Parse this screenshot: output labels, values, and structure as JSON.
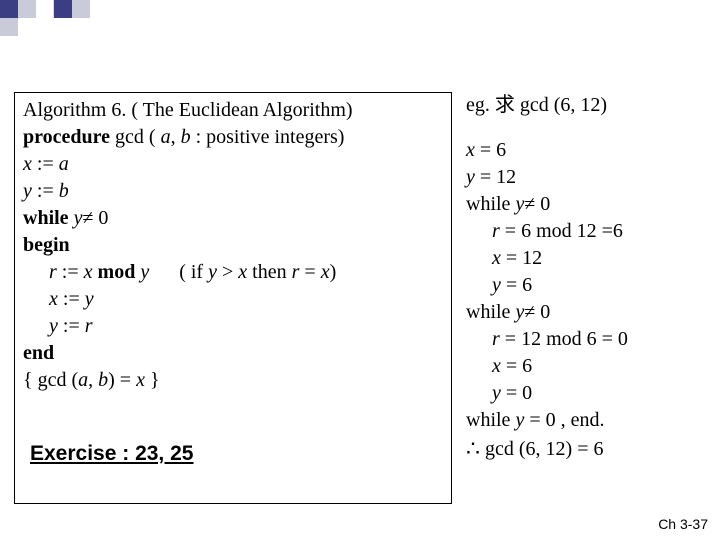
{
  "decor": {
    "colors": [
      "#3B3E82",
      "#C9CBD9",
      "#FFFFFF",
      "#3B3E82",
      "#C9CBD9",
      "#FFFFFF"
    ]
  },
  "algo": {
    "title_a": "Algorithm 6. ",
    "title_b": "( The Euclidean Algorithm)",
    "line2_a": "procedure ",
    "line2_b": "gcd ( ",
    "line2_c": "a",
    "line2_d": ", ",
    "line2_e": "b",
    "line2_f": " : positive integers)",
    "line3_a": "x",
    "line3_b": " := ",
    "line3_c": "a",
    "line4_a": "y",
    "line4_b": " := ",
    "line4_c": "b",
    "line5_a": "while ",
    "line5_b": "y",
    "line5_c": "≠ 0",
    "line6": "begin",
    "line7_a": "r",
    "line7_b": " := ",
    "line7_c": "x",
    "line7_d": " mod ",
    "line7_e": "y",
    "line7_gap": "      ",
    "line7_f": "( if ",
    "line7_g": "y",
    "line7_h": " > ",
    "line7_i": "x",
    "line7_j": " then ",
    "line7_k": "r",
    "line7_l": " = ",
    "line7_m": "x",
    "line7_n": ")",
    "line8_a": "x",
    "line8_b": " := ",
    "line8_c": "y",
    "line9_a": "y",
    "line9_b": " := ",
    "line9_c": "r",
    "line10": "end",
    "line11_a": "{ gcd (",
    "line11_b": "a",
    "line11_c": ", ",
    "line11_d": "b",
    "line11_e": ") = ",
    "line11_f": "x",
    "line11_g": " }"
  },
  "right": {
    "eg": "eg. 求 gcd (6, 12)",
    "r1_a": "x",
    "r1_b": " = 6",
    "r2_a": "y",
    "r2_b": " = 12",
    "r3_a": "while ",
    "r3_b": "y",
    "r3_c": "≠ 0",
    "r4_a": "r",
    "r4_b": " = 6 mod 12 =6",
    "r5_a": "x",
    "r5_b": " = 12",
    "r6_a": "y",
    "r6_b": " = 6",
    "r7_a": "while ",
    "r7_b": "y",
    "r7_c": "≠ 0",
    "r8_a": "r",
    "r8_b": " = 12 mod 6 = 0",
    "r9_a": "x",
    "r9_b": " = 6",
    "r10_a": "y",
    "r10_b": " = 0",
    "r11_a": "while ",
    "r11_b": "y",
    "r11_c": " = 0 , end.",
    "r12_a": "∴",
    "r12_b": " gcd (6, 12) = 6"
  },
  "exercise": "Exercise : 23, 25",
  "footer": "Ch 3-37"
}
